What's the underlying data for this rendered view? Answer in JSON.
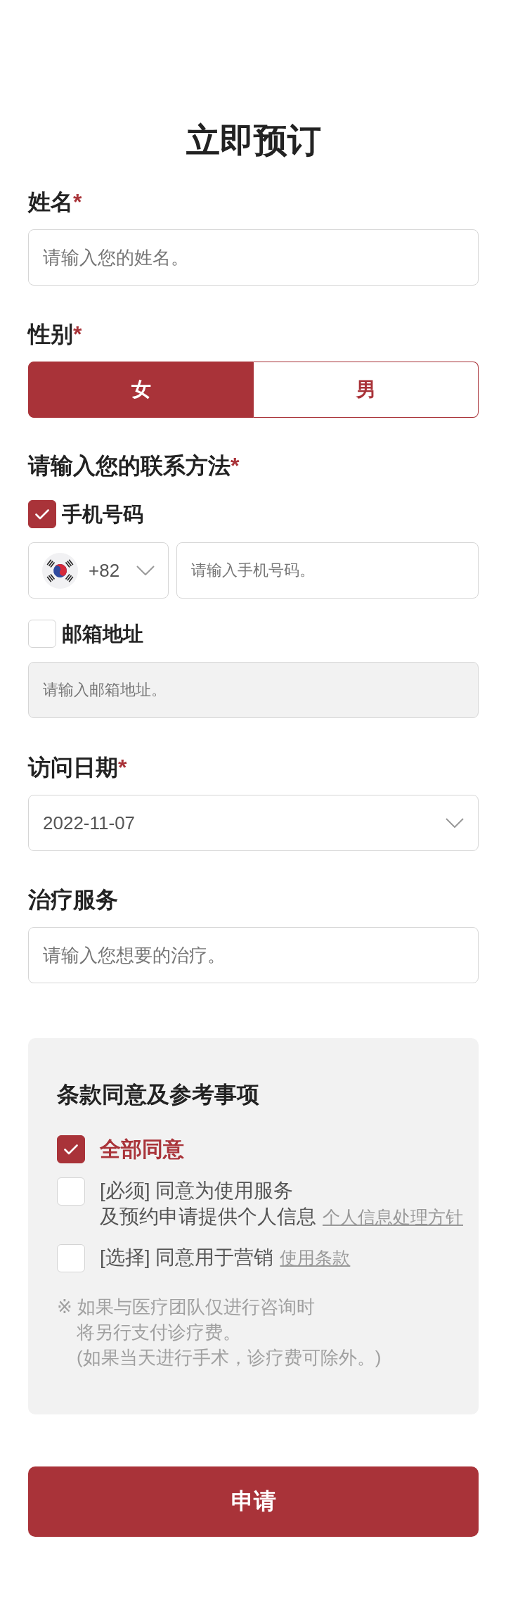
{
  "title": "立即预订",
  "name_field": {
    "label": "姓名",
    "required_mark": "*",
    "placeholder": "请输入您的姓名。"
  },
  "gender_field": {
    "label": "性别",
    "required_mark": "*",
    "options": [
      {
        "label": "女",
        "selected": true
      },
      {
        "label": "男",
        "selected": false
      }
    ]
  },
  "contact_field": {
    "label": "请输入您的联系方法",
    "required_mark": "*",
    "methods": [
      {
        "kind": "phone",
        "label": "手机号码",
        "checked": true,
        "country_code": "+82",
        "placeholder": "请输入手机号码。",
        "disabled": false
      },
      {
        "kind": "email",
        "label": "邮箱地址",
        "checked": false,
        "placeholder": "请输入邮箱地址。",
        "disabled": true
      }
    ]
  },
  "visit_date_field": {
    "label": "访问日期",
    "required_mark": "*",
    "value": "2022-11-07"
  },
  "treatment_field": {
    "label": "治疗服务",
    "placeholder": "请输入您想要的治疗。"
  },
  "terms": {
    "title": "条款同意及参考事项",
    "items": [
      {
        "kind": "all",
        "lines": [
          "全部同意"
        ],
        "checked": true
      },
      {
        "kind": "consent",
        "lines": [
          "[必须] 同意为使用服务",
          "及预约申请提供个人信息"
        ],
        "link": "个人信息处理方针",
        "checked": false
      },
      {
        "kind": "consent",
        "lines": [
          "[选择] 同意用于营销"
        ],
        "link": "使用条款",
        "checked": false
      }
    ],
    "note_lines": [
      "※ 如果与医疗团队仅进行咨询时",
      "将另行支付诊疗费。",
      "(如果当天进行手术，诊疗费可除外。)"
    ]
  },
  "submit_button": "申请"
}
